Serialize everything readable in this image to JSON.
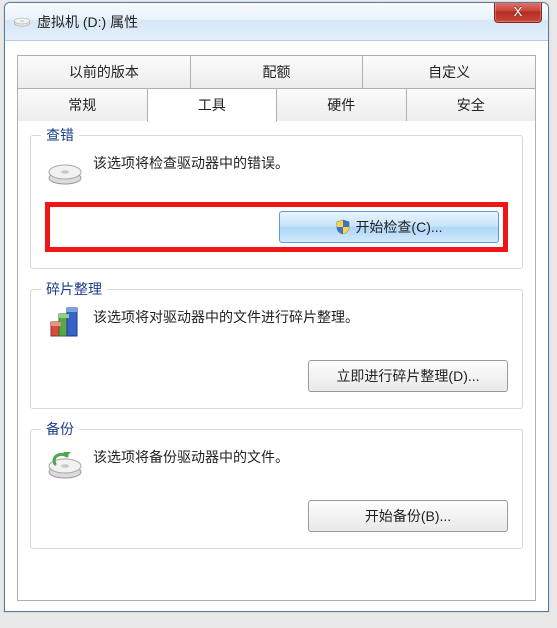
{
  "window": {
    "title": "虚拟机 (D:) 属性",
    "close_symbol": "X"
  },
  "tabs": {
    "row1": [
      "以前的版本",
      "配额",
      "自定义"
    ],
    "row2": [
      "常规",
      "工具",
      "硬件",
      "安全"
    ],
    "active": "工具"
  },
  "groups": {
    "check": {
      "legend": "查错",
      "desc": "该选项将检查驱动器中的错误。",
      "button": "开始检查(C)..."
    },
    "defrag": {
      "legend": "碎片整理",
      "desc": "该选项将对驱动器中的文件进行碎片整理。",
      "button": "立即进行碎片整理(D)..."
    },
    "backup": {
      "legend": "备份",
      "desc": "该选项将备份驱动器中的文件。",
      "button": "开始备份(B)..."
    }
  }
}
